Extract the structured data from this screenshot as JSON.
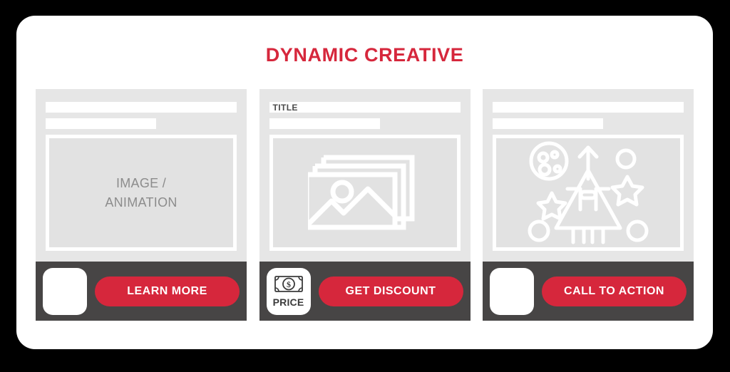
{
  "heading": "DYNAMIC CREATIVE",
  "colors": {
    "accent_red": "#d6273c",
    "footer_dark": "#474545",
    "card_gray": "#e6e6e6",
    "media_gray": "#e2e2e2",
    "placeholder_text": "#8c8c8c",
    "panel_white": "#ffffff"
  },
  "cards": [
    {
      "id": "card-image-animation",
      "headline_bar_label": "",
      "subline_bar_label": "",
      "media": {
        "kind": "text-placeholder",
        "lines": [
          "IMAGE /",
          "ANIMATION"
        ],
        "icon": ""
      },
      "logo_tile": {
        "icon": "",
        "label": ""
      },
      "cta_label": "LEARN MORE"
    },
    {
      "id": "card-title-gallery",
      "headline_bar_label": "TITLE",
      "subline_bar_label": "",
      "media": {
        "kind": "icon",
        "lines": [],
        "icon": "image-gallery-icon"
      },
      "logo_tile": {
        "icon": "banknote-dollar-icon",
        "label": "PRICE"
      },
      "cta_label": "GET DISCOUNT"
    },
    {
      "id": "card-celebration",
      "headline_bar_label": "",
      "subline_bar_label": "",
      "media": {
        "kind": "icon",
        "lines": [],
        "icon": "rocket-launch-confetti-icon"
      },
      "logo_tile": {
        "icon": "",
        "label": ""
      },
      "cta_label": "CALL TO ACTION"
    }
  ]
}
